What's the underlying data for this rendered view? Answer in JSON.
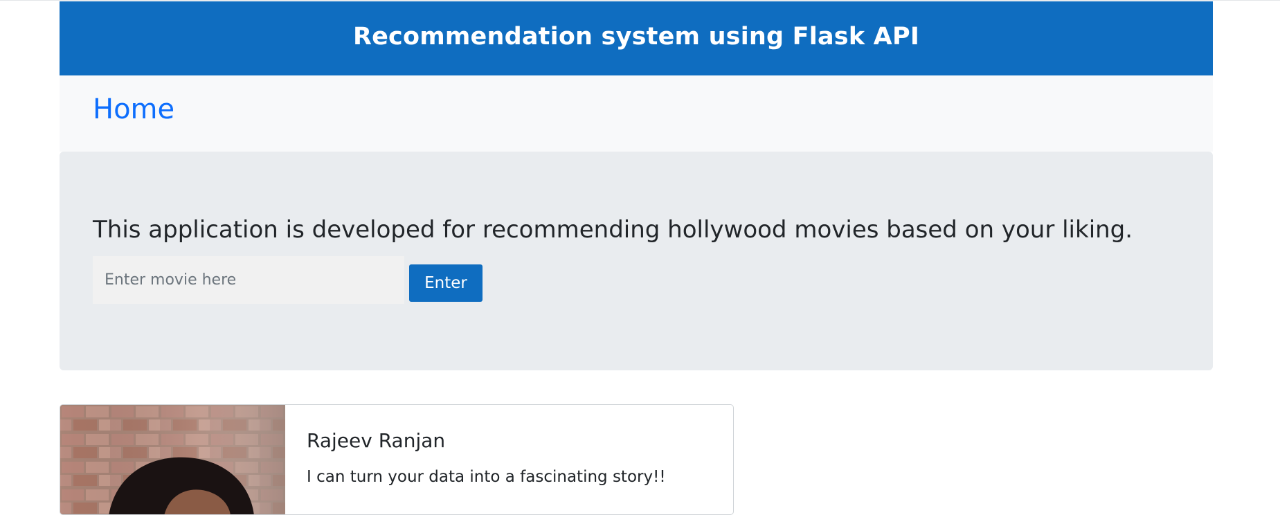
{
  "header": {
    "title": "Recommendation system using Flask API"
  },
  "nav": {
    "home_label": "Home"
  },
  "jumbotron": {
    "heading": "This application is developed for recommending hollywood movies based on your liking.",
    "input_placeholder": "Enter movie here",
    "input_value": "",
    "button_label": "Enter"
  },
  "card": {
    "name": "Rajeev Ranjan",
    "tagline": "I can turn your data into a fascinating story!!"
  },
  "colors": {
    "header_bg": "#0f6dc0",
    "link": "#0d6efd",
    "jumbotron_bg": "#e9ecef",
    "navbar_bg": "#f8f9fa"
  }
}
